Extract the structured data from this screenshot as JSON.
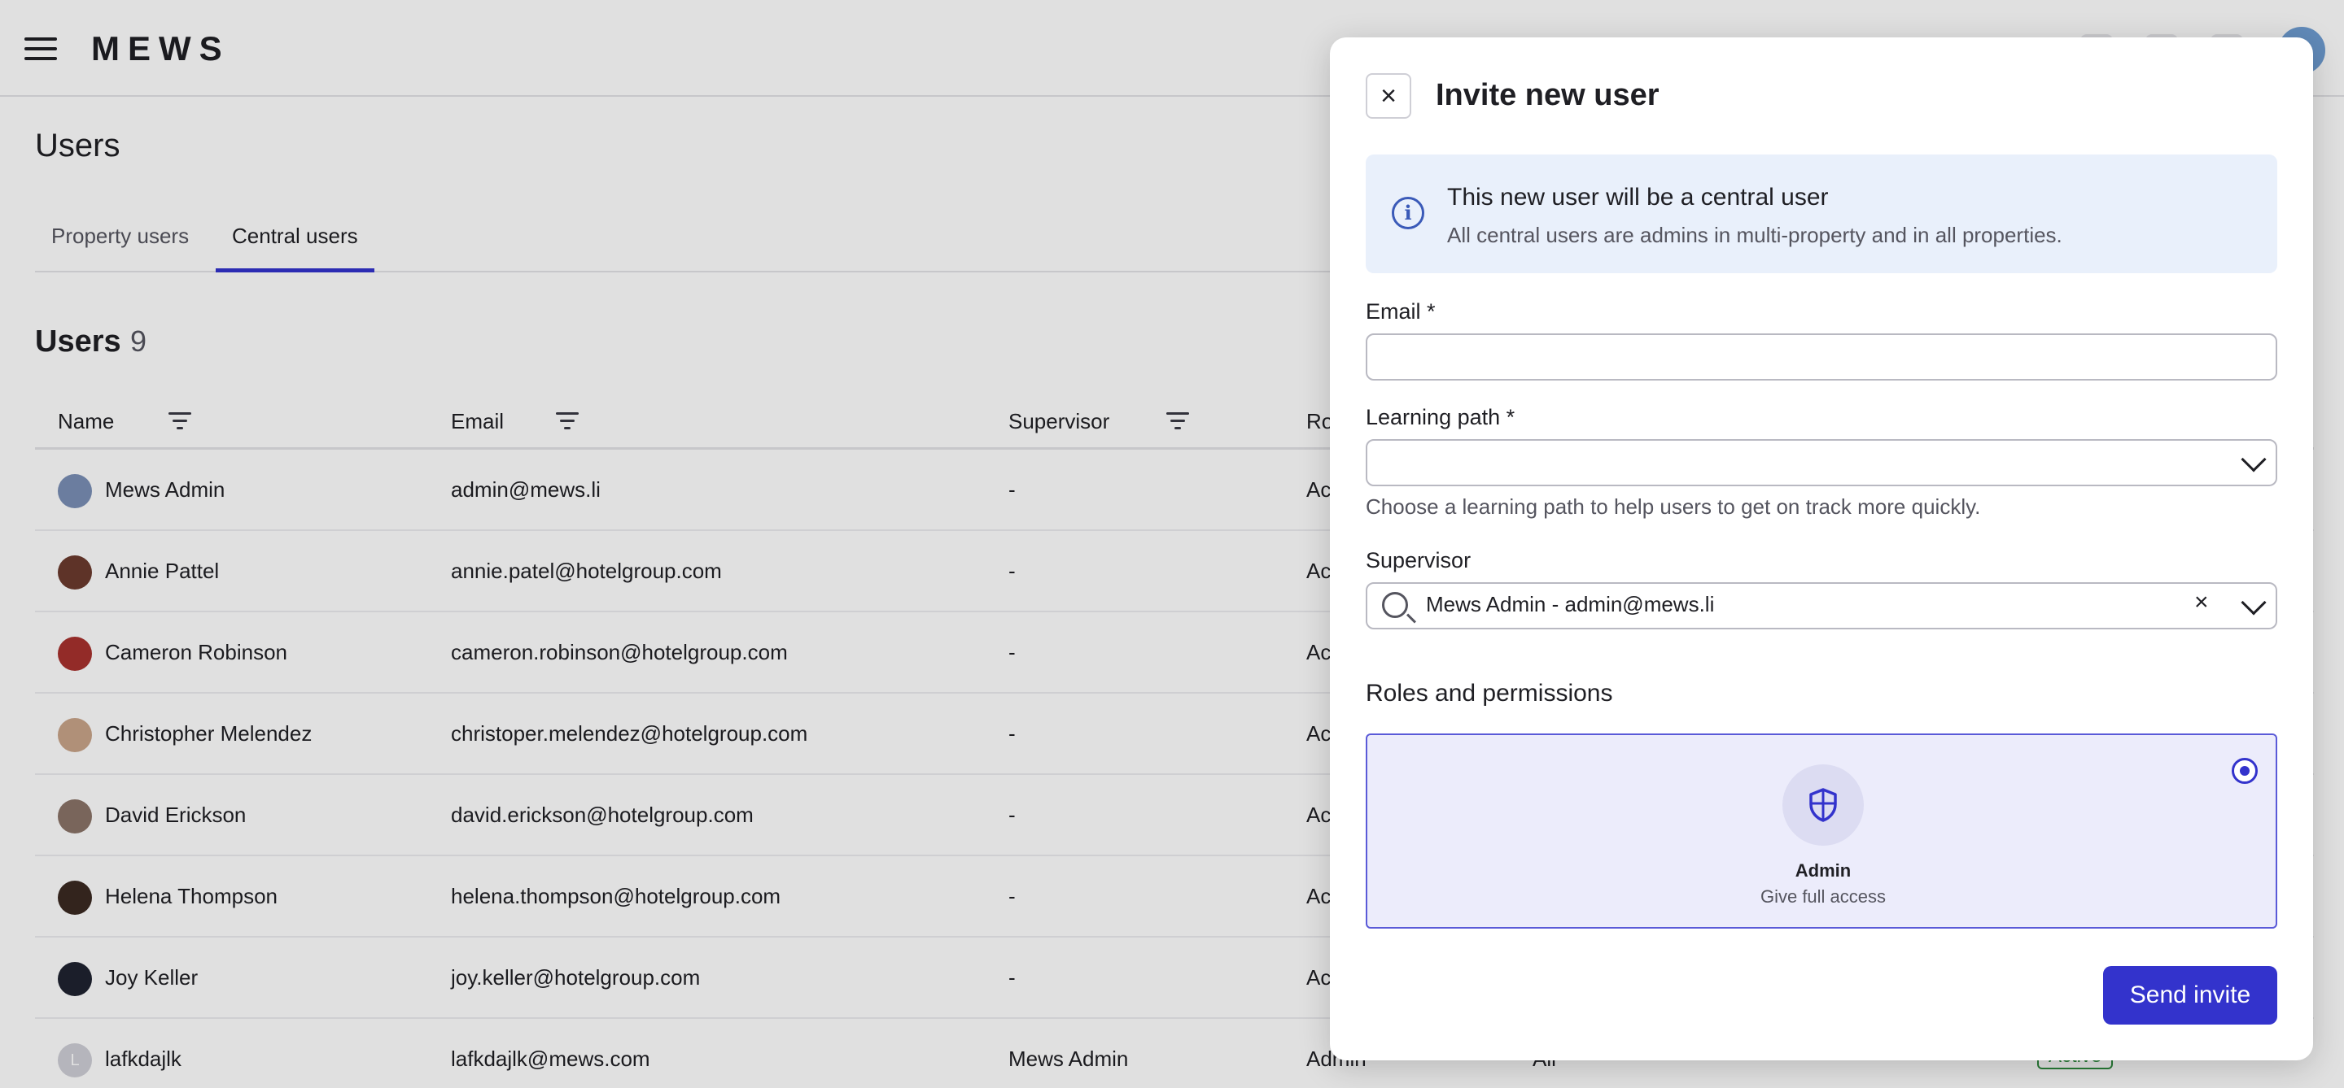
{
  "topbar": {
    "logo": "MEWS"
  },
  "page": {
    "title": "Users"
  },
  "tabs": [
    {
      "label": "Property users"
    },
    {
      "label": "Central users"
    }
  ],
  "section": {
    "title": "Users",
    "count": "9"
  },
  "table": {
    "columns": [
      "Name",
      "Email",
      "Supervisor",
      "Ro"
    ],
    "rows": [
      {
        "name": "Mews Admin",
        "email": "admin@mews.li",
        "supervisor": "-",
        "role": "Ac"
      },
      {
        "name": "Annie Pattel",
        "email": "annie.patel@hotelgroup.com",
        "supervisor": "-",
        "role": "Ac"
      },
      {
        "name": "Cameron Robinson",
        "email": "cameron.robinson@hotelgroup.com",
        "supervisor": "-",
        "role": "Ac"
      },
      {
        "name": "Christopher Melendez",
        "email": "christoper.melendez@hotelgroup.com",
        "supervisor": "-",
        "role": "Ac"
      },
      {
        "name": "David Erickson",
        "email": "david.erickson@hotelgroup.com",
        "supervisor": "-",
        "role": "Ac"
      },
      {
        "name": "Helena Thompson",
        "email": "helena.thompson@hotelgroup.com",
        "supervisor": "-",
        "role": "Ac"
      },
      {
        "name": "Joy Keller",
        "email": "joy.keller@hotelgroup.com",
        "supervisor": "-",
        "role": "Ac"
      },
      {
        "name": "lafkdajlk",
        "email": "lafkdajlk@mews.com",
        "supervisor": "Mews Admin",
        "role": "Admin",
        "extra": "All",
        "status": "Active",
        "initial": "L"
      }
    ]
  },
  "modal": {
    "title": "Invite new user",
    "info_title": "This new user will be a central user",
    "info_text": "All central users are admins in multi-property and in all properties.",
    "email_label": "Email *",
    "email_value": "",
    "learning_label": "Learning path *",
    "learning_value": "",
    "learning_helper": "Choose a learning path to help users to get on track more quickly.",
    "supervisor_label": "Supervisor",
    "supervisor_value": "Mews Admin - admin@mews.li",
    "roles_title": "Roles and permissions",
    "role_name": "Admin",
    "role_desc": "Give full access",
    "send_label": "Send invite"
  },
  "colors": {
    "accent": "#3333cc",
    "info_bg": "#e9f0fb",
    "role_card_bg": "#ececfb",
    "status_active": "#2e8a3e"
  },
  "icons": [
    "menu-icon",
    "info-icon",
    "close-icon",
    "search-icon",
    "chevron-down-icon",
    "shield-icon",
    "filter-icon"
  ]
}
